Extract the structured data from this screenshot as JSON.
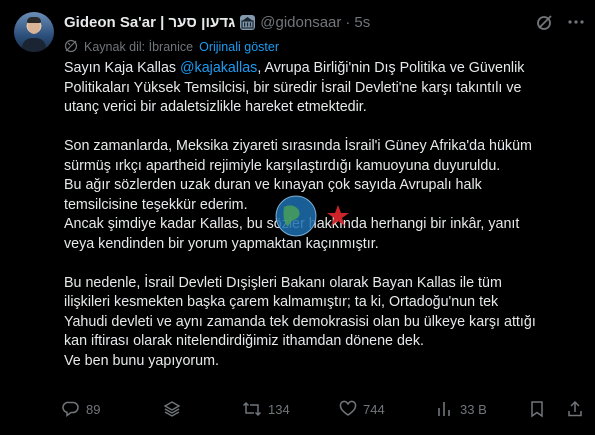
{
  "author": {
    "display_name": "Gideon Sa'ar | גדעון סער",
    "handle": "@gidonsaar",
    "separator": "·",
    "time": "5s"
  },
  "translation": {
    "source_label": "Kaynak dil: İbranice",
    "show_original": "Orijinali göster"
  },
  "body": {
    "p1": {
      "lead": "Sayın Kaja Kallas ",
      "mention": "@kajakallas",
      "rest_line1": ", Avrupa Birliği'nin Dış Politika ve Güvenlik",
      "line2": "Politikaları Yüksek Temsilcisi, bir süredir İsrail Devleti'ne karşı takıntılı ve",
      "line3": "utanç verici bir adaletsizlikle hareket etmektedir."
    },
    "p2": [
      "Son zamanlarda, Meksika ziyareti sırasında İsrail'i Güney Afrika'da hüküm",
      "sürmüş ırkçı apartheid rejimiyle karşılaştırdığı kamuoyuna duyuruldu.",
      "Bu ağır sözlerden uzak duran ve kınayan çok sayıda Avrupalı halk",
      "temsilcisine teşekkür ederim.",
      "Ancak şimdiye kadar Kallas, bu sözler hakkında herhangi bir inkâr, yanıt",
      "veya kendinden bir yorum yapmaktan kaçınmıştır."
    ],
    "p3": [
      "Bu nedenle, İsrail Devleti Dışişleri Bakanı olarak Bayan Kallas ile tüm",
      "ilişkileri kesmekten başka çarem kalmamıştır; ta ki, Ortadoğu'nun tek",
      "Yahudi devleti ve aynı zamanda tek demokrasisi olan bu ülkeye karşı attığı",
      "kan iftirası olarak nitelendirdiğimiz ithamdan dönene dek.",
      "Ve ben bunu yapıyorum."
    ]
  },
  "actions": {
    "replies": "89",
    "reposts": "134",
    "likes": "744",
    "views": "33 B"
  },
  "icons": {
    "badge": "government-badge-icon",
    "grok": "grok-icon",
    "more": "more-icon",
    "globe": "translate-globe-icon",
    "reply": "reply-icon",
    "layers": "layers-icon",
    "repost": "repost-icon",
    "like": "heart-icon",
    "views": "views-icon",
    "bookmark": "bookmark-icon",
    "share": "share-icon"
  },
  "colors": {
    "background": "#000000",
    "text": "#e7e9ea",
    "muted": "#71767b",
    "link": "#1d9bf0",
    "watermark_red": "#d7262b"
  }
}
